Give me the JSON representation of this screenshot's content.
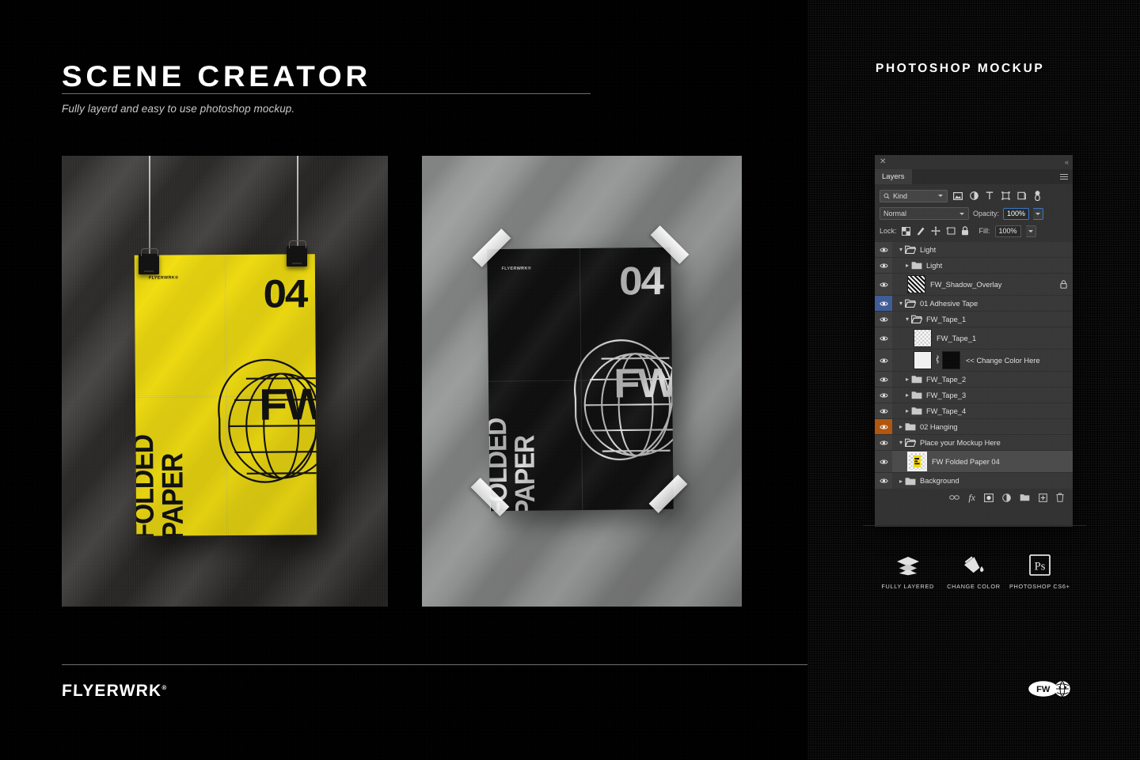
{
  "header": {
    "title": "SCENE CREATOR",
    "subtitle": "Fully layerd and easy to use photoshop mockup.",
    "right_title": "PHOTOSHOP MOCKUP"
  },
  "footer": {
    "brand": "FLYERWRK",
    "brand_sup": "®",
    "mark_text": "FW"
  },
  "posters": [
    {
      "name": "yellow-folded-poster",
      "brand": "FLYERWRK®",
      "number": "04",
      "line1": "FOLDED",
      "line2": "PAPER",
      "monogram": "FW",
      "paper_color": "#f4e011",
      "ink_color": "#121212",
      "mounting": "binder-clips"
    },
    {
      "name": "black-folded-poster",
      "brand": "FLYERWRK®",
      "number": "04",
      "line1": "FOLDED",
      "line2": "PAPER",
      "monogram": "FW",
      "paper_color": "#131313",
      "ink_color": "#d9d9d9",
      "mounting": "adhesive-tape"
    }
  ],
  "photoshop_panel": {
    "tab": "Layers",
    "close_glyph": "✕",
    "collapse_glyph": "«",
    "filter": {
      "kind_label": "Kind",
      "icons": [
        "pixel-layer-icon",
        "adjustment-layer-icon",
        "type-layer-icon",
        "shape-layer-icon",
        "smart-object-icon",
        "filter-toggle-icon"
      ]
    },
    "blend": {
      "mode": "Normal",
      "opacity_label": "Opacity:",
      "opacity_value": "100%"
    },
    "lock": {
      "label": "Lock:",
      "icons": [
        "lock-transparent-pixels-icon",
        "lock-image-pixels-icon",
        "lock-position-icon",
        "lock-artboard-icon",
        "lock-all-icon"
      ],
      "fill_label": "Fill:",
      "fill_value": "100%"
    },
    "layers": [
      {
        "name": "Light",
        "indent": 0,
        "type": "group",
        "expanded": true,
        "visible": true,
        "eye_state": "normal",
        "selected": false,
        "locked": false
      },
      {
        "name": "Light",
        "indent": 1,
        "type": "group",
        "expanded": false,
        "visible": true,
        "eye_state": "normal",
        "selected": false,
        "locked": false
      },
      {
        "name": "FW_Shadow_Overlay",
        "indent": 1,
        "type": "layer",
        "thumb": "hatch",
        "visible": true,
        "eye_state": "normal",
        "selected": false,
        "locked": true
      },
      {
        "name": "01 Adhesive Tape",
        "indent": 0,
        "type": "group",
        "expanded": true,
        "visible": true,
        "eye_state": "blue",
        "selected": false,
        "locked": false
      },
      {
        "name": "FW_Tape_1",
        "indent": 1,
        "type": "group",
        "expanded": true,
        "visible": true,
        "eye_state": "normal",
        "selected": false,
        "locked": false
      },
      {
        "name": "FW_Tape_1",
        "indent": 2,
        "type": "layer",
        "thumb": "transparent",
        "visible": true,
        "eye_state": "normal",
        "selected": false,
        "locked": false
      },
      {
        "name": "<< Change Color Here",
        "indent": 2,
        "type": "layer-masked",
        "thumb": "fill",
        "visible": true,
        "eye_state": "normal",
        "selected": false,
        "locked": false
      },
      {
        "name": "FW_Tape_2",
        "indent": 1,
        "type": "group",
        "expanded": false,
        "visible": true,
        "eye_state": "normal",
        "selected": false,
        "locked": false
      },
      {
        "name": "FW_Tape_3",
        "indent": 1,
        "type": "group",
        "expanded": false,
        "visible": true,
        "eye_state": "normal",
        "selected": false,
        "locked": false
      },
      {
        "name": "FW_Tape_4",
        "indent": 1,
        "type": "group",
        "expanded": false,
        "visible": true,
        "eye_state": "normal",
        "selected": false,
        "locked": false
      },
      {
        "name": "02 Hanging",
        "indent": 0,
        "type": "group",
        "expanded": false,
        "visible": true,
        "eye_state": "orange",
        "selected": false,
        "locked": false
      },
      {
        "name": "Place your Mockup Here",
        "indent": 0,
        "type": "group",
        "expanded": true,
        "visible": true,
        "eye_state": "normal",
        "selected": false,
        "locked": false
      },
      {
        "name": "FW Folded Paper 04",
        "indent": 1,
        "type": "smart-object",
        "thumb": "smart",
        "visible": true,
        "eye_state": "normal",
        "selected": true,
        "locked": false
      },
      {
        "name": "Background",
        "indent": 0,
        "type": "group",
        "expanded": false,
        "visible": true,
        "eye_state": "normal",
        "selected": false,
        "locked": false
      }
    ],
    "footer_buttons": [
      "link-layers-icon",
      "layer-style-fx-icon",
      "add-layer-mask-icon",
      "new-adjustment-layer-icon",
      "new-group-icon",
      "new-layer-icon",
      "delete-layer-icon"
    ],
    "fx_label": "fx"
  },
  "features": [
    {
      "label": "FULLY LAYERED",
      "icon": "layers-stack-icon"
    },
    {
      "label": "CHANGE COLOR",
      "icon": "paint-bucket-icon"
    },
    {
      "label": "PHOTOSHOP CS6+",
      "icon": "photoshop-ps-icon",
      "icon_text": "Ps"
    }
  ],
  "colors": {
    "background": "#000000",
    "accent_yellow": "#f4e011",
    "panel_bg": "#323232",
    "eye_blue": "#3f5c96",
    "eye_orange": "#b0560e",
    "scene_a_wall": "#3b3938",
    "scene_b_wall": "#909091"
  }
}
